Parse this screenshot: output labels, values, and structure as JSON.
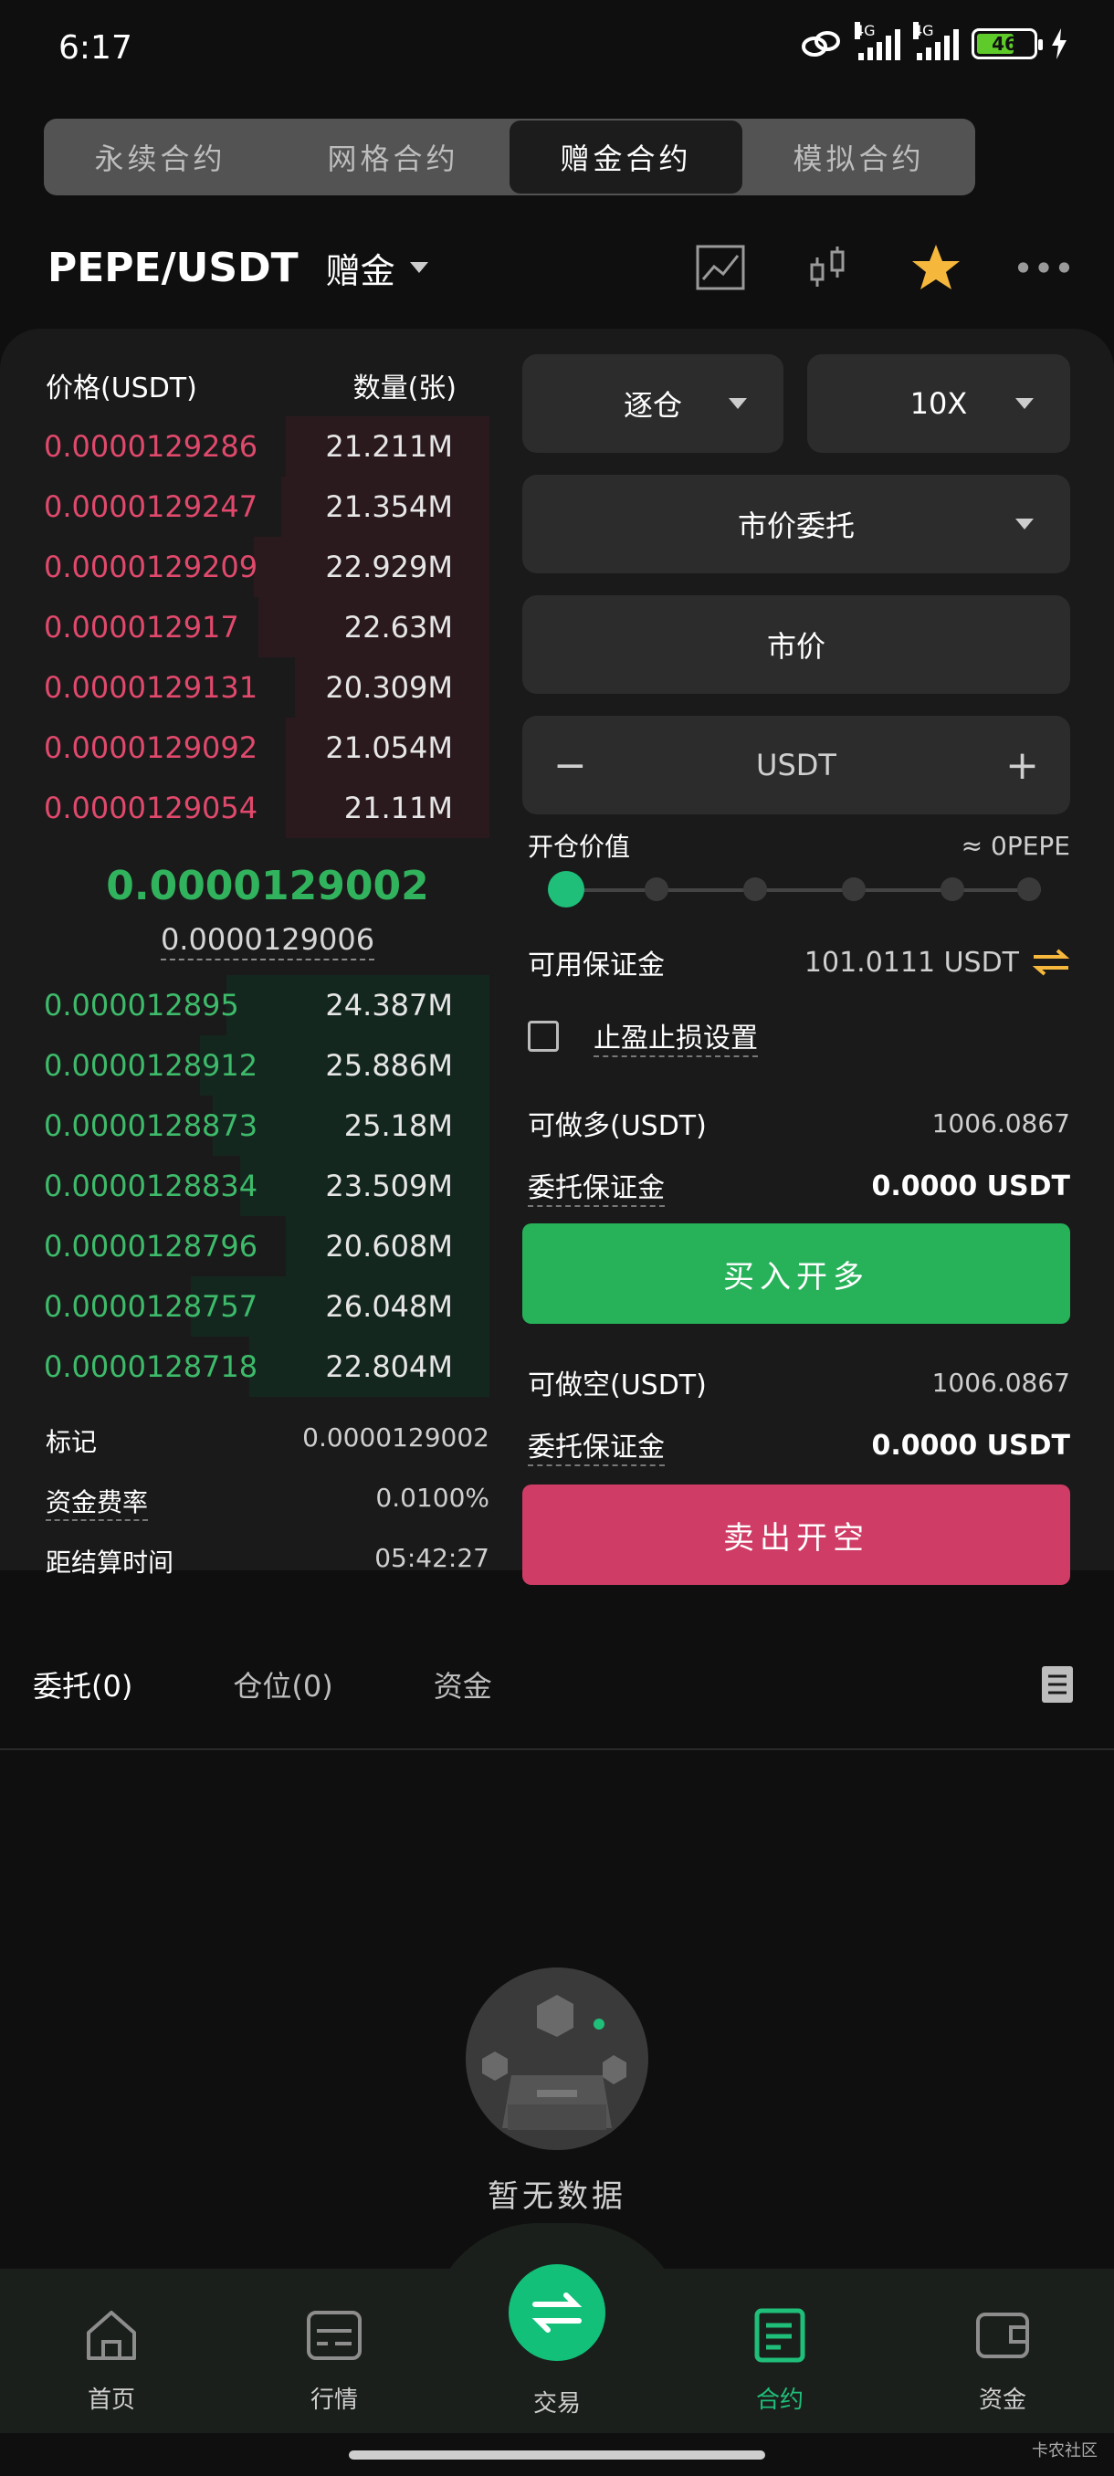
{
  "status": {
    "time": "6:17",
    "net1": "4G",
    "net2": "4G",
    "battery": "46"
  },
  "tabs": [
    "永续合约",
    "网格合约",
    "赠金合约",
    "模拟合约"
  ],
  "pair": {
    "symbol": "PEPE/USDT",
    "type": "赠金"
  },
  "orderbook": {
    "price_header": "价格(USDT)",
    "qty_header": "数量(张)",
    "asks": [
      {
        "price": "0.0000129286",
        "qty": "21.211M",
        "depth": 0.45
      },
      {
        "price": "0.0000129247",
        "qty": "21.354M",
        "depth": 0.46
      },
      {
        "price": "0.0000129209",
        "qty": "22.929M",
        "depth": 0.52
      },
      {
        "price": "0.000012917",
        "qty": "22.63M",
        "depth": 0.51
      },
      {
        "price": "0.0000129131",
        "qty": "20.309M",
        "depth": 0.43
      },
      {
        "price": "0.0000129092",
        "qty": "21.054M",
        "depth": 0.45
      },
      {
        "price": "0.0000129054",
        "qty": "21.11M",
        "depth": 0.45
      }
    ],
    "last_price": "0.0000129002",
    "mark_price": "0.0000129006",
    "bids": [
      {
        "price": "0.000012895",
        "qty": "24.387M",
        "depth": 0.58
      },
      {
        "price": "0.0000128912",
        "qty": "25.886M",
        "depth": 0.64
      },
      {
        "price": "0.0000128873",
        "qty": "25.18M",
        "depth": 0.61
      },
      {
        "price": "0.0000128834",
        "qty": "23.509M",
        "depth": 0.55
      },
      {
        "price": "0.0000128796",
        "qty": "20.608M",
        "depth": 0.45
      },
      {
        "price": "0.0000128757",
        "qty": "26.048M",
        "depth": 0.66
      },
      {
        "price": "0.0000128718",
        "qty": "22.804M",
        "depth": 0.53
      }
    ]
  },
  "info": {
    "mark_label": "标记",
    "mark_value": "0.0000129002",
    "funding_label": "资金费率",
    "funding_value": "0.0100%",
    "settle_label": "距结算时间",
    "settle_value": "05:42:27"
  },
  "form": {
    "margin_mode": "逐仓",
    "leverage": "10X",
    "order_type": "市价委托",
    "price_field": "市价",
    "amount_unit": "USDT",
    "minus": "−",
    "plus": "+",
    "open_value_label": "开仓价值",
    "open_value": "≈ 0PEPE",
    "slider_percent": 0,
    "available_label": "可用保证金",
    "available_value": "101.0111 USDT",
    "tpsl_label": "止盈止损设置",
    "long_max_label": "可做多(USDT)",
    "long_max_value": "1006.0867",
    "long_margin_label": "委托保证金",
    "long_margin_value": "0.0000 USDT",
    "buy_button": "买入开多",
    "short_max_label": "可做空(USDT)",
    "short_max_value": "1006.0867",
    "short_margin_label": "委托保证金",
    "short_margin_value": "0.0000 USDT",
    "sell_button": "卖出开空"
  },
  "orders_tabs": [
    "委托(0)",
    "仓位(0)",
    "资金"
  ],
  "empty_text": "暂无数据",
  "nav": {
    "home": "首页",
    "market": "行情",
    "trade": "交易",
    "contract": "合约",
    "assets": "资金"
  },
  "watermark": "卡农社区",
  "colors": {
    "ask": "#e0496c",
    "bid": "#3dbb6a",
    "buy": "#27b25a",
    "sell": "#cf3c66",
    "accent": "#1fbf7a"
  }
}
